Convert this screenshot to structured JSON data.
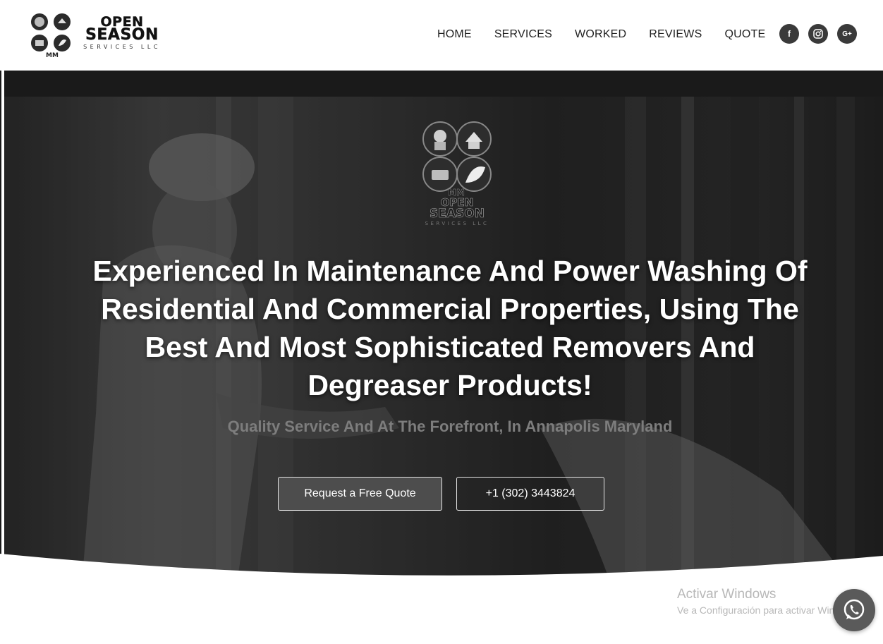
{
  "brand": {
    "line1": "OPEN",
    "line2": "SEASON",
    "line3": "SERVICES LLC",
    "monogram": "MM"
  },
  "nav": {
    "items": [
      {
        "label": "HOME"
      },
      {
        "label": "SERVICES"
      },
      {
        "label": "WORKED"
      },
      {
        "label": "REVIEWS"
      },
      {
        "label": "QUOTE"
      }
    ]
  },
  "social": {
    "icons": [
      "facebook-icon",
      "instagram-icon",
      "google-plus-icon"
    ],
    "labels": {
      "facebook": "f",
      "google_plus": "G+"
    }
  },
  "hero": {
    "headline": "Experienced In Maintenance And Power Washing Of Residential And Commercial Properties, Using The Best And Most Sophisticated Removers And Degreaser Products!",
    "subheadline": "Quality Service And At The Forefront, In Annapolis Maryland",
    "primary_button": "Request a Free Quote",
    "secondary_button": "+1 (302) 3443824"
  },
  "watermark": {
    "title": "Activar Windows",
    "subtitle": "Ve a Configuración para activar Windows."
  },
  "colors": {
    "header_bg": "#ffffff",
    "hero_dark": "#1a1a1a",
    "accent_grey": "#4d4d4d",
    "text_white": "#ffffff"
  }
}
